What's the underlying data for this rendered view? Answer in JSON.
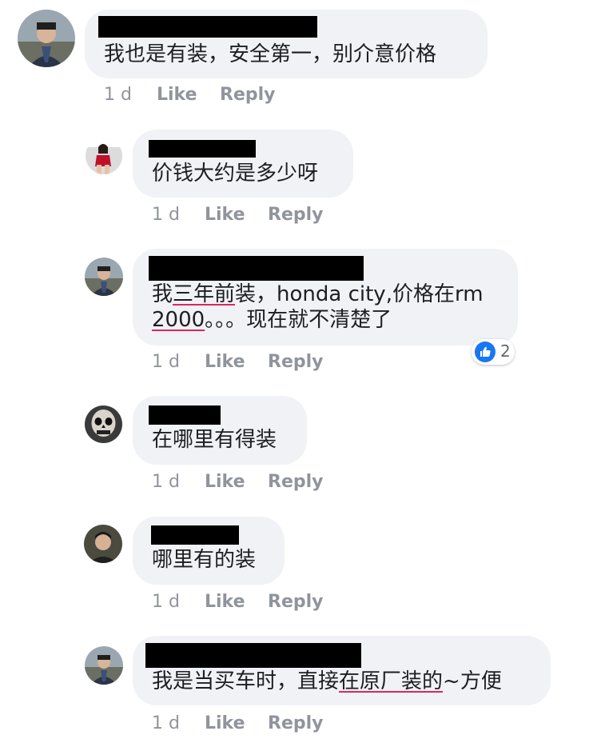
{
  "comments": [
    {
      "text": "我也是有装，安全第一，别介意价格",
      "time": "1 d",
      "like": "Like",
      "reply": "Reply"
    },
    {
      "text": "价钱大约是多少呀",
      "time": "1 d",
      "like": "Like",
      "reply": "Reply"
    },
    {
      "line1_pre": "我",
      "line1_err": "三年前",
      "line1_post": "装，honda city,价格在rm",
      "line2_err": "2000",
      "line2_post": "。。。现在就不清楚了",
      "time": "1 d",
      "like": "Like",
      "reply": "Reply",
      "reaction_count": "2"
    },
    {
      "text": "在哪里有得装",
      "time": "1 d",
      "like": "Like",
      "reply": "Reply"
    },
    {
      "text": "哪里有的装",
      "time": "1 d",
      "like": "Like",
      "reply": "Reply"
    },
    {
      "pre": "我是当买车时，直接",
      "err": "在原厂装的",
      "post": "~方便",
      "time": "1 d",
      "like": "Like",
      "reply": "Reply"
    }
  ],
  "colors": {
    "bubble": "#f0f2f5",
    "meta": "#90949c",
    "reaction": "#1877f2",
    "spellcheck": "#e0245e"
  },
  "icons": [
    "like-reaction-icon"
  ]
}
